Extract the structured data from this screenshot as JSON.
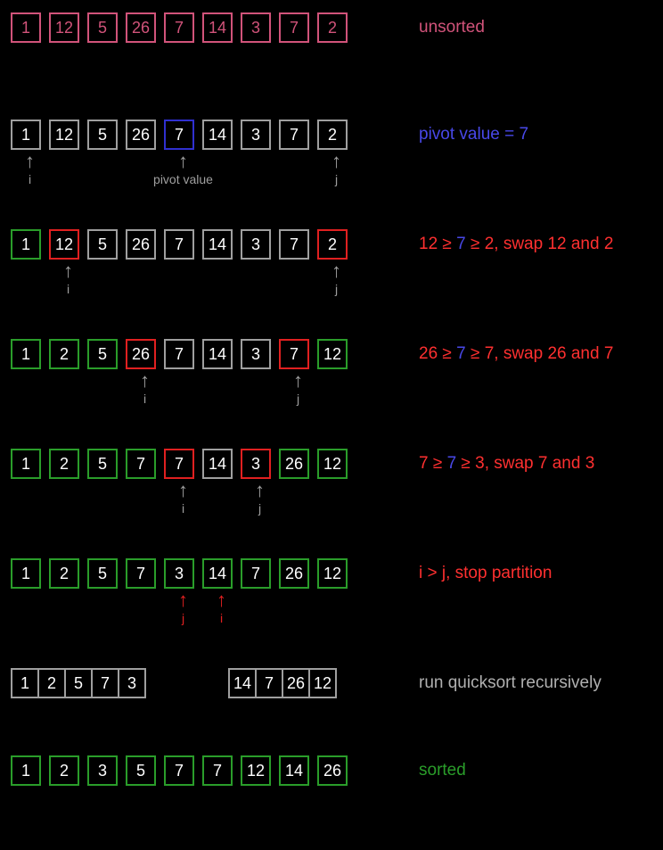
{
  "rows": {
    "r0": {
      "cells": [
        {
          "v": "1",
          "c": "pink"
        },
        {
          "v": "12",
          "c": "pink"
        },
        {
          "v": "5",
          "c": "pink"
        },
        {
          "v": "26",
          "c": "pink"
        },
        {
          "v": "7",
          "c": "pink"
        },
        {
          "v": "14",
          "c": "pink"
        },
        {
          "v": "3",
          "c": "pink"
        },
        {
          "v": "7",
          "c": "pink"
        },
        {
          "v": "2",
          "c": "pink"
        }
      ],
      "label": [
        {
          "t": "unsorted",
          "c": "pink"
        }
      ]
    },
    "r1": {
      "cells": [
        {
          "v": "1",
          "c": "gray"
        },
        {
          "v": "12",
          "c": "gray"
        },
        {
          "v": "5",
          "c": "gray"
        },
        {
          "v": "26",
          "c": "gray"
        },
        {
          "v": "7",
          "c": "blue"
        },
        {
          "v": "14",
          "c": "gray"
        },
        {
          "v": "3",
          "c": "gray"
        },
        {
          "v": "7",
          "c": "gray"
        },
        {
          "v": "2",
          "c": "gray"
        }
      ],
      "label": [
        {
          "t": "pivot value = 7",
          "c": "blue"
        }
      ],
      "pointers": [
        {
          "idx": 0,
          "label": "i",
          "c": "gray"
        },
        {
          "idx": 4,
          "label": "pivot value",
          "c": "gray"
        },
        {
          "idx": 8,
          "label": "j",
          "c": "gray"
        }
      ]
    },
    "r2": {
      "cells": [
        {
          "v": "1",
          "c": "green"
        },
        {
          "v": "12",
          "c": "red"
        },
        {
          "v": "5",
          "c": "gray"
        },
        {
          "v": "26",
          "c": "gray"
        },
        {
          "v": "7",
          "c": "gray"
        },
        {
          "v": "14",
          "c": "gray"
        },
        {
          "v": "3",
          "c": "gray"
        },
        {
          "v": "7",
          "c": "gray"
        },
        {
          "v": "2",
          "c": "red"
        }
      ],
      "label": [
        {
          "t": "12 ≥ ",
          "c": "red"
        },
        {
          "t": "7",
          "c": "blue"
        },
        {
          "t": " ≥ 2, swap 12 and 2",
          "c": "red"
        }
      ],
      "pointers": [
        {
          "idx": 1,
          "label": "i",
          "c": "gray"
        },
        {
          "idx": 8,
          "label": "j",
          "c": "gray"
        }
      ]
    },
    "r3": {
      "cells": [
        {
          "v": "1",
          "c": "green"
        },
        {
          "v": "2",
          "c": "green"
        },
        {
          "v": "5",
          "c": "green"
        },
        {
          "v": "26",
          "c": "red"
        },
        {
          "v": "7",
          "c": "gray"
        },
        {
          "v": "14",
          "c": "gray"
        },
        {
          "v": "3",
          "c": "gray"
        },
        {
          "v": "7",
          "c": "red"
        },
        {
          "v": "12",
          "c": "green"
        }
      ],
      "label": [
        {
          "t": "26 ≥ ",
          "c": "red"
        },
        {
          "t": "7",
          "c": "blue"
        },
        {
          "t": " ≥ 7, swap 26 and 7",
          "c": "red"
        }
      ],
      "pointers": [
        {
          "idx": 3,
          "label": "i",
          "c": "gray"
        },
        {
          "idx": 7,
          "label": "j",
          "c": "gray"
        }
      ]
    },
    "r4": {
      "cells": [
        {
          "v": "1",
          "c": "green"
        },
        {
          "v": "2",
          "c": "green"
        },
        {
          "v": "5",
          "c": "green"
        },
        {
          "v": "7",
          "c": "green"
        },
        {
          "v": "7",
          "c": "red"
        },
        {
          "v": "14",
          "c": "gray"
        },
        {
          "v": "3",
          "c": "red"
        },
        {
          "v": "26",
          "c": "green"
        },
        {
          "v": "12",
          "c": "green"
        }
      ],
      "label": [
        {
          "t": "7 ≥ ",
          "c": "red"
        },
        {
          "t": "7",
          "c": "blue"
        },
        {
          "t": " ≥ 3, swap 7 and 3",
          "c": "red"
        }
      ],
      "pointers": [
        {
          "idx": 4,
          "label": "i",
          "c": "gray"
        },
        {
          "idx": 6,
          "label": "j",
          "c": "gray"
        }
      ]
    },
    "r5": {
      "cells": [
        {
          "v": "1",
          "c": "green"
        },
        {
          "v": "2",
          "c": "green"
        },
        {
          "v": "5",
          "c": "green"
        },
        {
          "v": "7",
          "c": "green"
        },
        {
          "v": "3",
          "c": "green"
        },
        {
          "v": "14",
          "c": "green"
        },
        {
          "v": "7",
          "c": "green"
        },
        {
          "v": "26",
          "c": "green"
        },
        {
          "v": "12",
          "c": "green"
        }
      ],
      "label": [
        {
          "t": "i > j, stop partition",
          "c": "red"
        }
      ],
      "pointers": [
        {
          "idx": 4,
          "label": "j",
          "c": "red"
        },
        {
          "idx": 5,
          "label": "i",
          "c": "red"
        }
      ]
    },
    "r6": {
      "left": [
        "1",
        "2",
        "5",
        "7",
        "3"
      ],
      "right": [
        "14",
        "7",
        "26",
        "12"
      ],
      "label": [
        {
          "t": "run quicksort recursively",
          "c": "gray"
        }
      ]
    },
    "r7": {
      "cells": [
        {
          "v": "1",
          "c": "green"
        },
        {
          "v": "2",
          "c": "green"
        },
        {
          "v": "3",
          "c": "green"
        },
        {
          "v": "5",
          "c": "green"
        },
        {
          "v": "7",
          "c": "green"
        },
        {
          "v": "7",
          "c": "green"
        },
        {
          "v": "12",
          "c": "green"
        },
        {
          "v": "14",
          "c": "green"
        },
        {
          "v": "26",
          "c": "green"
        }
      ],
      "label": [
        {
          "t": "sorted",
          "c": "green"
        }
      ]
    }
  }
}
